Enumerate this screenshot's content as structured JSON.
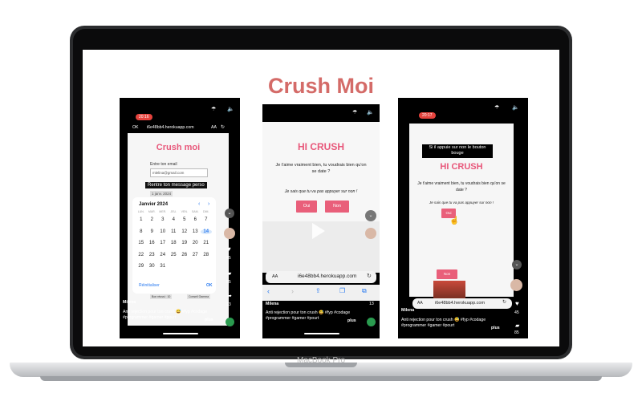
{
  "slide_title": "Crush Moi",
  "laptop_label": "MacBook Pro",
  "phone1": {
    "status_time": "20:16",
    "nav_ok": "OK",
    "nav_url": "i6e48bb4.herokuapp.com",
    "nav_aa": "AA",
    "app_title": "Crush moi",
    "email_label": "Entre ton email",
    "email_value": "mlelina@gmail.com",
    "caption": "Rentre ton message perso",
    "date_chip": "1 janv. 2024",
    "calendar": {
      "month": "Janvier 2024",
      "days_header": [
        "LUN.",
        "MAR.",
        "MER.",
        "JEU.",
        "VEN.",
        "SAM.",
        "DIM."
      ],
      "dates": [
        "1",
        "2",
        "3",
        "4",
        "5",
        "6",
        "7",
        "8",
        "9",
        "10",
        "11",
        "12",
        "13",
        "14",
        "15",
        "16",
        "17",
        "18",
        "19",
        "20",
        "21",
        "22",
        "23",
        "24",
        "25",
        "26",
        "27",
        "28",
        "29",
        "30",
        "31"
      ],
      "selected": "14",
      "reset": "Réinitialiser",
      "ok": "OK"
    },
    "btn_left": "Bon réussi : 10",
    "btn_right": "Conseil Gamma",
    "counts": [
      "45",
      "85",
      "13"
    ],
    "username": "Milena",
    "desc": "Anti rejection pour ton crush 😅 #fyp #codage #programmer #gamer #pourt",
    "more": "plus"
  },
  "phone2": {
    "heading": "HI CRUSH",
    "question": "Je t'aime vraiment bien, tu voudrais bien qu'on se date ?",
    "tease": "Je sais que tu va pas appuyer sur non !",
    "yes": "Oui",
    "no": "Non",
    "url_aa": "AA",
    "url": "i6e48bb4.herokuapp.com",
    "count": "13",
    "username": "Milena",
    "desc": "Anti rejection pour ton crush 😅 #fyp #codage #programmer #gamer #pourt",
    "more": "plus"
  },
  "phone3": {
    "status_time": "20:17",
    "caption": "Si il appuie sur non le bouton bouge",
    "heading": "HI CRUSH",
    "question": "Je t'aime vraiment bien, tu voudrais bien qu'on se date ?",
    "tease": "Je sais que tu va pas appuyer sur non !",
    "yes": "Oui",
    "no": "Non",
    "url_aa": "AA",
    "url": "i6e48bb4.herokuapp.com",
    "counts": [
      "45",
      "85",
      "13"
    ],
    "username": "Milena",
    "desc": "Anti rejection pour ton crush 😅 #fyp #codage #programmer #gamer #pourt",
    "more": "plus"
  },
  "colors": {
    "title": "#d46b68",
    "pink": "#e95f7a",
    "heading": "#e8577a",
    "status": "#e5433d"
  }
}
